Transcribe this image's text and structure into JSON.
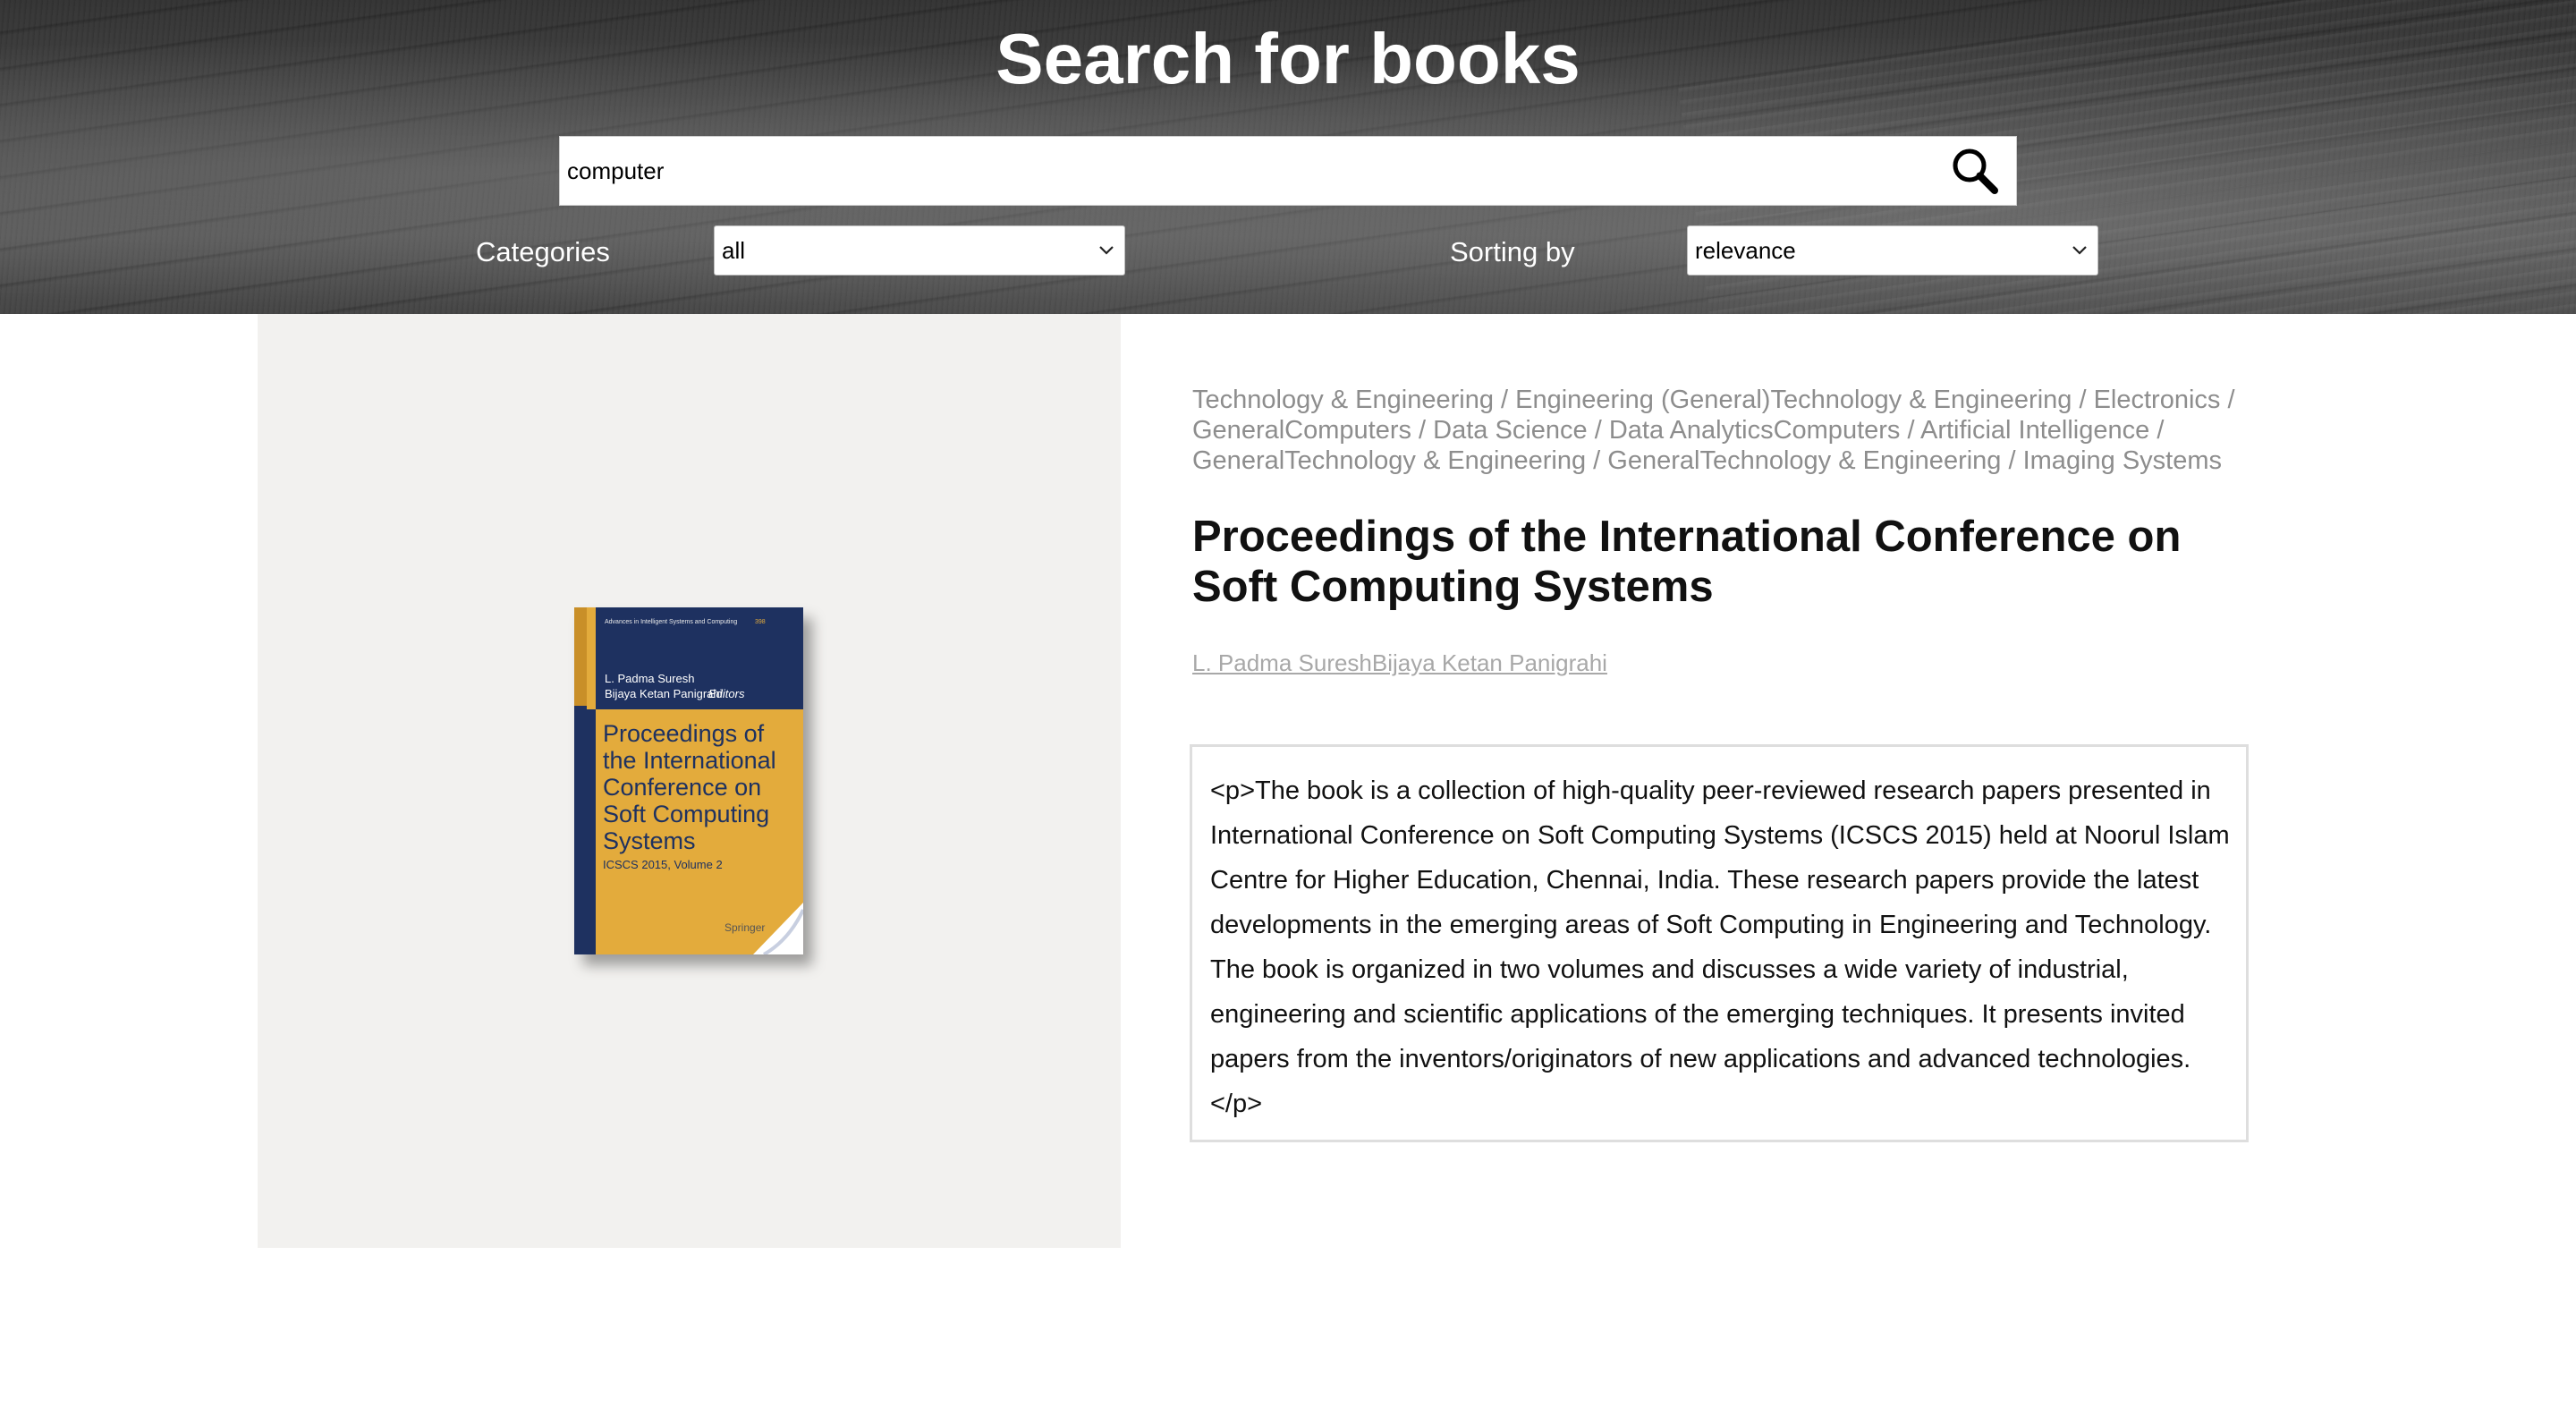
{
  "header": {
    "title": "Search for books"
  },
  "search": {
    "value": "computer",
    "button_icon": "search-icon"
  },
  "filters": {
    "categories_label": "Categories",
    "categories_selected": "all",
    "sorting_label": "Sorting by",
    "sorting_selected": "relevance"
  },
  "book": {
    "categories": "Technology & Engineering / Engineering (General)Technology & Engineering / Electronics / GeneralComputers / Data Science / Data AnalyticsComputers / Artificial Intelligence / GeneralTechnology & Engineering / GeneralTechnology & Engineering / Imaging Systems",
    "title": "Proceedings of the International Conference on Soft Computing Systems",
    "authors": "L. Padma SureshBijaya Ketan Panigrahi",
    "description": "<p>The book is a collection of high-quality peer-reviewed research papers presented in International Conference on Soft Computing Systems (ICSCS 2015) held at Noorul Islam Centre for Higher Education, Chennai, India. These research papers provide the latest developments in the emerging areas of Soft Computing in Engineering and Technology. The book is organized in two volumes and discusses a wide variety of industrial, engineering and scientific applications of the emerging techniques. It presents invited papers from the inventors/originators of new applications and advanced technologies.</p>",
    "cover": {
      "series": "Advances in Intelligent Systems and Computing",
      "series_number": "398",
      "editors_line1": "L. Padma Suresh",
      "editors_line2": "Bijaya Ketan Panigrahi",
      "editors_label": "Editors",
      "title_line1": "Proceedings of",
      "title_line2": "the International",
      "title_line3": "Conference on",
      "title_line4": "Soft Computing",
      "title_line5": "Systems",
      "volume": "ICSCS 2015, Volume 2",
      "publisher": "Springer",
      "colors": {
        "navy": "#1e3160",
        "gold": "#e3ab3c",
        "spine": "#c98f28"
      }
    }
  }
}
